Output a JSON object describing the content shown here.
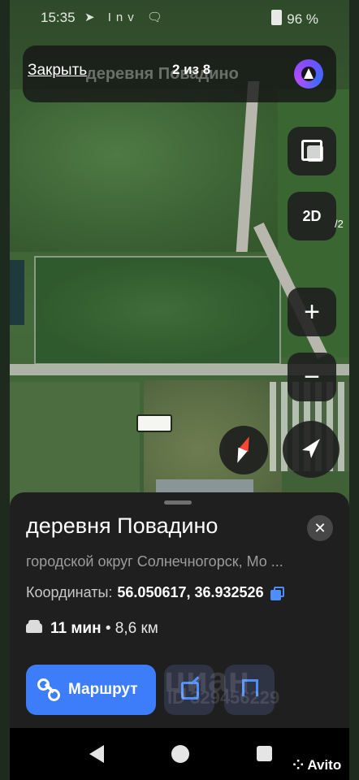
{
  "status_bar": {
    "time": "15:35",
    "notification_icons": "➤ Inv 🗨",
    "battery": "96 %"
  },
  "top_bar": {
    "close_label": "Закрыть",
    "counter": "2 из 8",
    "search_text": "деревня Повадино"
  },
  "map_controls": {
    "mode_label": "2D",
    "zoom_in": "+",
    "zoom_out": "−",
    "edge_text": "/2"
  },
  "place": {
    "title": "деревня Повадино",
    "subtitle": "городской округ Солнечногорск, Мо ...",
    "coordinates_label": "Координаты:",
    "coordinates_value": "56.050617, 36.932526",
    "duration": "11 мин",
    "distance": "• 8,6 км"
  },
  "actions": {
    "route_label": "Маршрут"
  },
  "watermark": {
    "logo": "циан",
    "id": "ID 329456229",
    "avito": "Avito"
  },
  "colors": {
    "accent_blue": "#3d7dfa",
    "sheet_bg": "#1f1f1f",
    "compass_red": "#ff4436"
  }
}
